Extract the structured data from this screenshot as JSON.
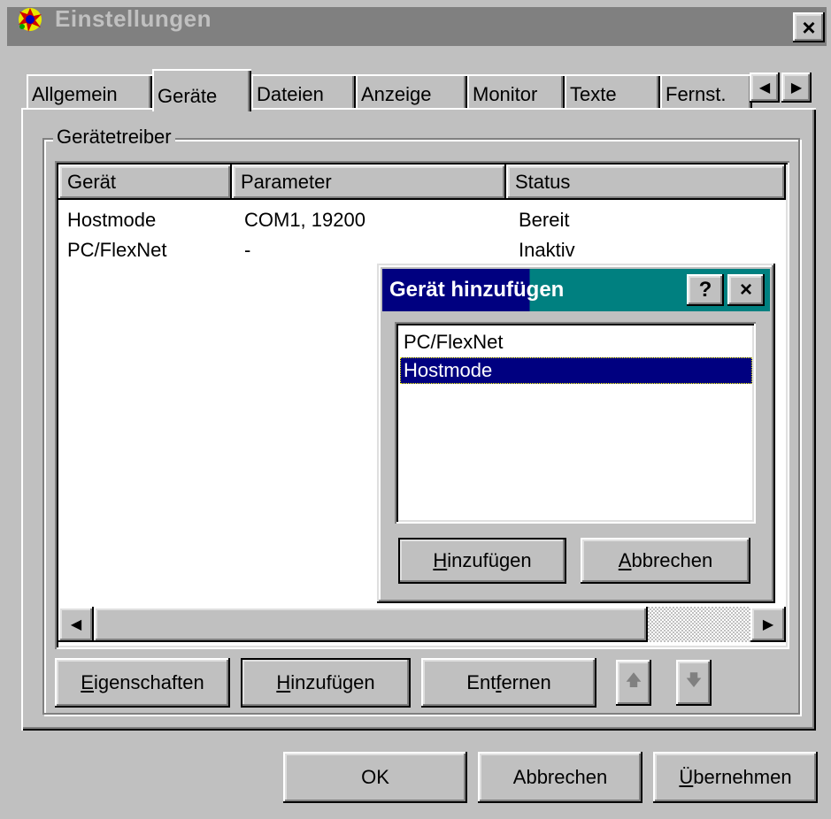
{
  "window": {
    "title": "Einstellungen",
    "close_label": "×"
  },
  "tabs": [
    {
      "label": "Allgemein"
    },
    {
      "label": "Geräte"
    },
    {
      "label": "Dateien"
    },
    {
      "label": "Anzeige"
    },
    {
      "label": "Monitor"
    },
    {
      "label": "Texte"
    },
    {
      "label": "Fernst."
    }
  ],
  "tab_scroll": {
    "left": "◀",
    "right": "▶"
  },
  "group": {
    "label": "Gerätetreiber"
  },
  "list": {
    "columns": [
      "Gerät",
      "Parameter",
      "Status"
    ],
    "rows": [
      [
        "Hostmode",
        "COM1, 19200",
        "Bereit"
      ],
      [
        "PC/FlexNet",
        "-",
        "Inaktiv"
      ]
    ]
  },
  "hscroll": {
    "left": "◀",
    "right": "▶"
  },
  "group_buttons": {
    "properties": {
      "u": "E",
      "rest": "igenschaften"
    },
    "add": {
      "u": "H",
      "rest": "inzufügen"
    },
    "remove": {
      "pre": "Ent",
      "u": "f",
      "rest": "ernen"
    },
    "up": "🡅",
    "down": "🡇"
  },
  "buttons": {
    "ok": "OK",
    "cancel": "Abbrechen",
    "apply": {
      "u": "Ü",
      "rest": "bernehmen"
    }
  },
  "popup": {
    "title": "Gerät hinzufügen",
    "help": "?",
    "close": "×",
    "items": [
      "PC/FlexNet",
      "Hostmode"
    ],
    "selected": "Hostmode",
    "add": {
      "u": "H",
      "rest": "inzufügen"
    },
    "cancel": {
      "u": "A",
      "rest": "bbrechen"
    }
  }
}
